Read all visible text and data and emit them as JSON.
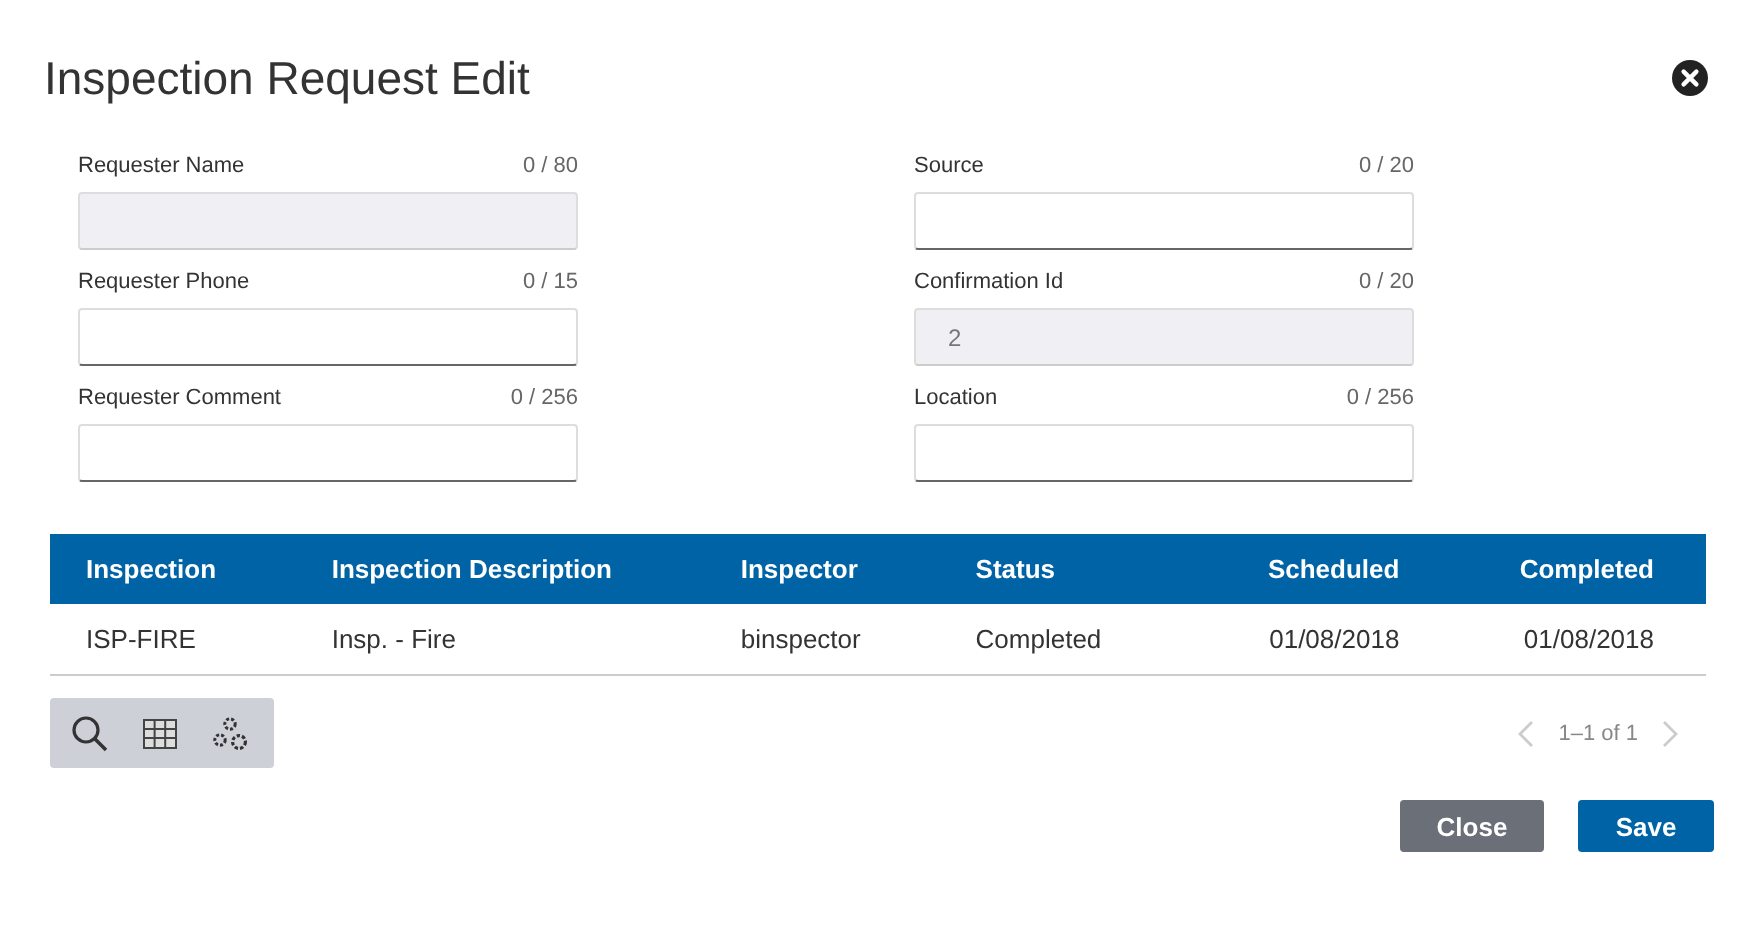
{
  "window": {
    "title": "Inspection Request Edit"
  },
  "fields": [
    {
      "label": "Requester Name",
      "counter": "0 / 80",
      "disabled": true
    },
    {
      "label": "Source",
      "counter": "0 / 20",
      "disabled": false
    },
    {
      "label": "Requester Phone",
      "counter": "0 / 15",
      "disabled": false
    },
    {
      "label": "Confirmation Id",
      "counter": "0 / 20",
      "value": "2",
      "disabled": true
    },
    {
      "label": "Requester Comment",
      "counter": "0 / 256",
      "disabled": false
    },
    {
      "label": "Location",
      "counter": "0 / 256",
      "disabled": false
    }
  ],
  "table": {
    "columns": [
      "Inspection",
      "Inspection Description",
      "Inspector",
      "Status",
      "Scheduled",
      "Completed"
    ],
    "rows": [
      [
        "ISP-FIRE",
        "Insp. - Fire",
        "binspector",
        "Completed",
        "01/08/2018",
        "01/08/2018"
      ]
    ]
  },
  "pager": {
    "text": "1–1 of 1"
  },
  "buttons": [
    {
      "label": "Close",
      "kind": "secondary"
    },
    {
      "label": "Save",
      "kind": "primary"
    }
  ]
}
